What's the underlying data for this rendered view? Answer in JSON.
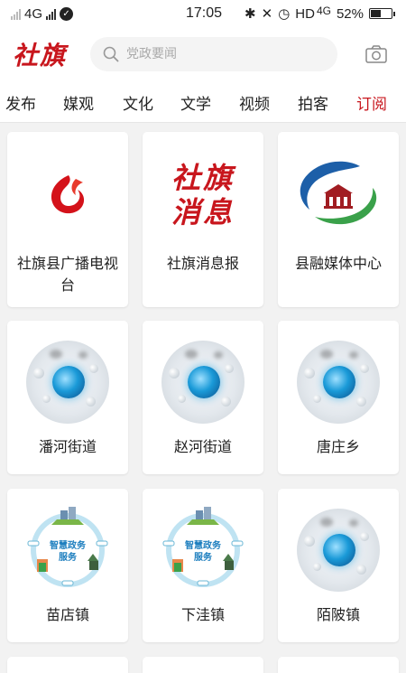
{
  "status_bar": {
    "network": "4G",
    "time": "17:05",
    "hd_label": "HD",
    "network2": "4G",
    "battery_percent": "52%",
    "battery_level": 0.52
  },
  "header": {
    "logo": "社旗",
    "search_placeholder": "党政要闻"
  },
  "tabs": [
    {
      "label": "发布"
    },
    {
      "label": "媒观"
    },
    {
      "label": "文化"
    },
    {
      "label": "文学"
    },
    {
      "label": "视频"
    },
    {
      "label": "拍客"
    },
    {
      "label": "订阅",
      "active": true
    }
  ],
  "subscriptions": [
    {
      "name": "社旗县广播电视台",
      "icon": "tv-station-logo-icon"
    },
    {
      "name": "社旗消息报",
      "icon": "newspaper-logo-icon",
      "logo_text": [
        "社旗",
        "消息"
      ]
    },
    {
      "name": "县融媒体中心",
      "icon": "media-center-logo-icon"
    },
    {
      "name": "潘河街道",
      "icon": "globe-icon"
    },
    {
      "name": "赵河街道",
      "icon": "globe-icon"
    },
    {
      "name": "唐庄乡",
      "icon": "globe-icon"
    },
    {
      "name": "苗店镇",
      "icon": "smart-government-icon",
      "logo_text": [
        "智慧政务",
        "服务"
      ]
    },
    {
      "name": "下洼镇",
      "icon": "smart-government-icon",
      "logo_text": [
        "智慧政务",
        "服务"
      ]
    },
    {
      "name": "陌陂镇",
      "icon": "globe-icon"
    }
  ],
  "colors": {
    "brand_red": "#c8161d",
    "active_tab": "#c8161d",
    "background": "#f2f2f2"
  }
}
